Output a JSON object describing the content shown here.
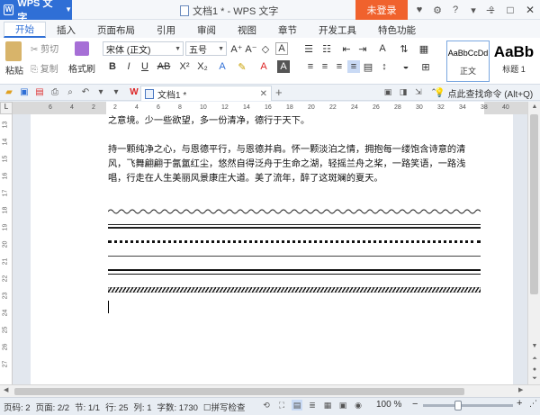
{
  "titlebar": {
    "app_name": "WPS 文字",
    "doc_title": "文档1 * - WPS 文字",
    "login": "未登录",
    "help": "?"
  },
  "menu": {
    "tabs": [
      "开始",
      "插入",
      "页面布局",
      "引用",
      "审阅",
      "视图",
      "章节",
      "开发工具",
      "特色功能"
    ]
  },
  "ribbon": {
    "paste": "粘贴",
    "cut": "剪切",
    "copy": "复制",
    "format_painter": "格式刷",
    "font": "宋体 (正文)",
    "size": "五号",
    "style1_preview": "AaBbCcDd",
    "style1_name": "正文",
    "style2_preview": "AaBb",
    "style2_name": "标题 1"
  },
  "doc_tab": {
    "label": "文档1 *"
  },
  "search_cmd": "点此查找命令 (Alt+Q)",
  "ruler": {
    "h_ticks": [
      "6",
      "4",
      "2",
      "2",
      "4",
      "6",
      "8",
      "10",
      "12",
      "14",
      "16",
      "18",
      "20",
      "22",
      "24",
      "26",
      "28",
      "30",
      "32",
      "34",
      "38",
      "40"
    ],
    "v_ticks": [
      "13",
      "14",
      "15",
      "16",
      "17",
      "18",
      "19",
      "20",
      "21",
      "22",
      "23",
      "24",
      "25",
      "26",
      "27"
    ]
  },
  "document": {
    "para0": "之意境。少一些欲望，多一份清净，德行于天下。",
    "para1": "持一颗纯净之心，与恩德平行，与恩德并肩。怀一颗淡泊之情，拥抱每一缕饱含诗意的清风，飞舞翩翩于氤氲红尘，悠然自得泛舟于生命之湖，轻摇兰舟之桨，一路笑语，一路浅唱，行走在人生美丽风景康庄大道。美了流年，醉了这斑斓的夏天。"
  },
  "status": {
    "page": "页码: 2",
    "pages": "页面: 2/2",
    "section": "节: 1/1",
    "row": "行: 25",
    "col": "列: 1",
    "words": "字数: 1730",
    "spell": "拼写检查",
    "zoom": "100 %"
  }
}
